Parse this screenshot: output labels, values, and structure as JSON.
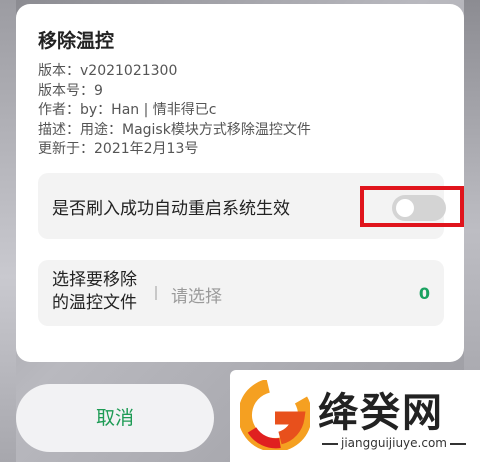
{
  "dialog": {
    "title": "移除温控",
    "meta": [
      "版本：v2021021300",
      "版本号：9",
      "作者：by：Han | 情非得已c",
      "描述：用途：Magisk模块方式移除温控文件",
      "更新于：2021年2月13号"
    ]
  },
  "reboot_option": {
    "label": "是否刷入成功自动重启系统生效",
    "enabled": false
  },
  "file_select": {
    "label": "选择要移除的温控文件",
    "placeholder": "请选择",
    "count": "0"
  },
  "footer": {
    "cancel_label": "取消"
  },
  "watermark": {
    "text": "绛癸网",
    "url": "jiangguijiuye.com"
  },
  "colors": {
    "accent_green": "#1e9b55",
    "highlight_red": "#e0141c",
    "switch_off": "#d4d4d4"
  },
  "icons": {
    "watermark_logo": "orange-g-logo"
  }
}
